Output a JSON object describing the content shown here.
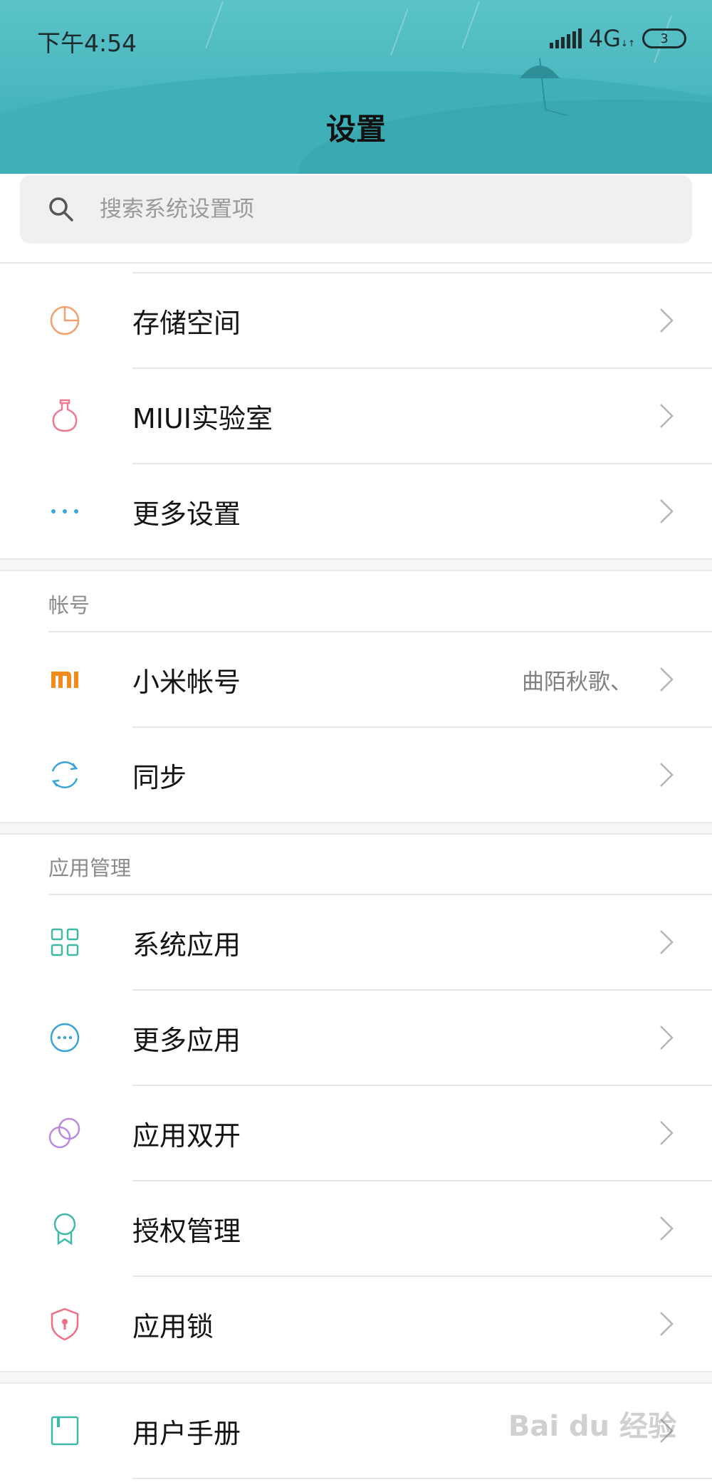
{
  "status_bar": {
    "time": "下午4:54",
    "network": "4G",
    "battery": "3"
  },
  "header": {
    "title": "设置"
  },
  "search": {
    "placeholder": "搜索系统设置项",
    "icon": "search-icon"
  },
  "group1": {
    "items": [
      {
        "label": "存储空间",
        "icon": "pie-chart-icon",
        "color": "#f2a06e"
      },
      {
        "label": "MIUI实验室",
        "icon": "flask-icon",
        "color": "#ef7b93"
      },
      {
        "label": "更多设置",
        "icon": "more-dots-icon",
        "color": "#3aa3d8"
      }
    ]
  },
  "account_section": {
    "title": "帐号",
    "items": [
      {
        "label": "小米帐号",
        "value": "曲陌秋歌、",
        "icon": "mi-logo-icon",
        "color": "#f38a1c"
      },
      {
        "label": "同步",
        "icon": "sync-icon",
        "color": "#3aa3d8"
      }
    ]
  },
  "apps_section": {
    "title": "应用管理",
    "items": [
      {
        "label": "系统应用",
        "icon": "grid-icon",
        "color": "#3fb8a6"
      },
      {
        "label": "更多应用",
        "icon": "more-circle-icon",
        "color": "#3aa3d8"
      },
      {
        "label": "应用双开",
        "icon": "dual-circle-icon",
        "color": "#b98ae0"
      },
      {
        "label": "授权管理",
        "icon": "badge-icon",
        "color": "#3fb8a6"
      },
      {
        "label": "应用锁",
        "icon": "shield-lock-icon",
        "color": "#ef6f86"
      }
    ]
  },
  "group4": {
    "items": [
      {
        "label": "用户手册",
        "icon": "manual-icon",
        "color": "#3fb8a6"
      }
    ]
  },
  "watermark": "Bai du 经验"
}
